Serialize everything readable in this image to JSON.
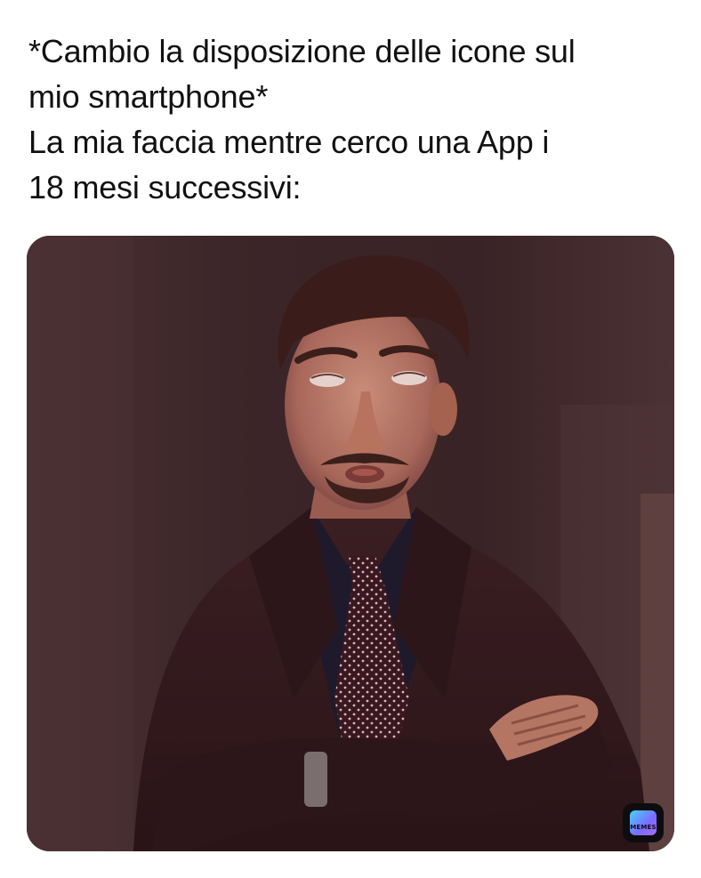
{
  "caption": {
    "line1": "*Cambio la disposizione delle icone sul",
    "line2": "mio smartphone*",
    "line3": "La mia faccia mentre cerco una App i",
    "line4": "18 mesi successivi:"
  },
  "image": {
    "subject": "man-eye-roll-photo",
    "tint": "#3a2427"
  },
  "watermark": {
    "text": "MEMES",
    "icon": "memes-app-icon"
  },
  "colors": {
    "background": "#ffffff",
    "text": "#111111"
  }
}
